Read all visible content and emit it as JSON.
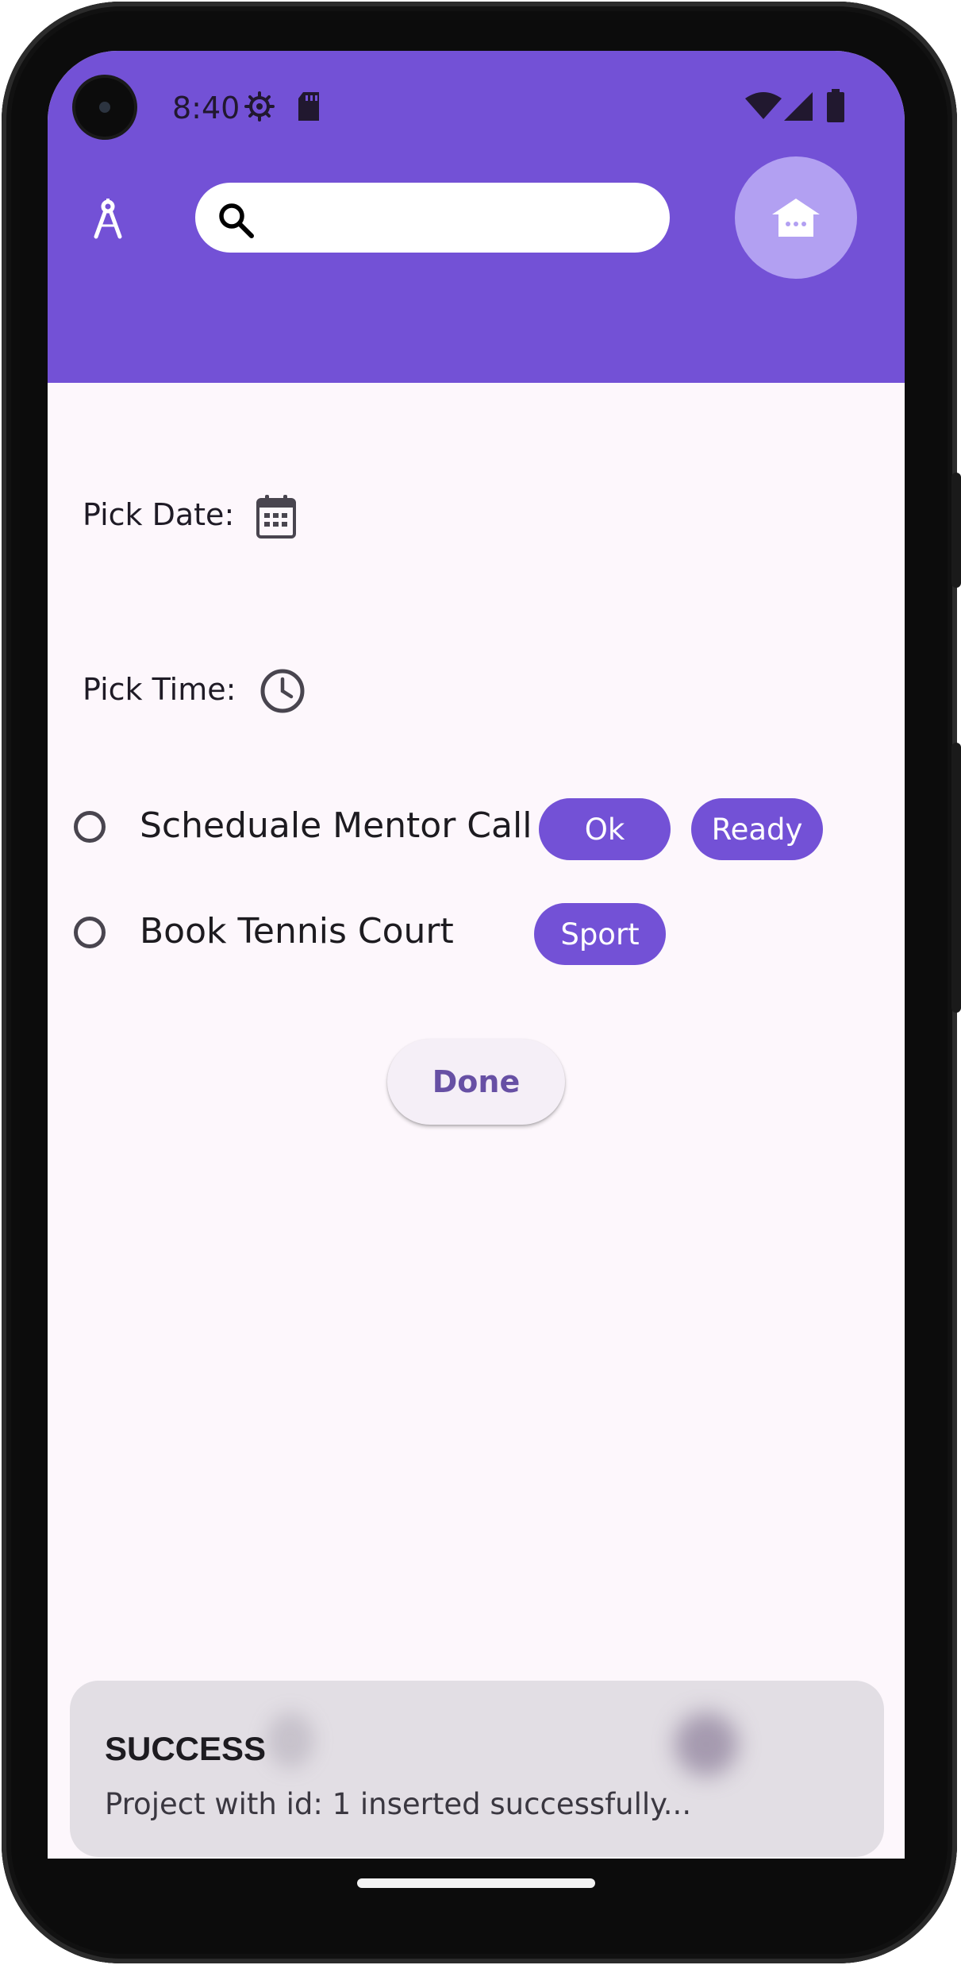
{
  "status_bar": {
    "time": "8:40"
  },
  "app_bar": {
    "search": {
      "value": "",
      "placeholder": ""
    },
    "background": "#7351d6",
    "fab_color": "#b2a0f2"
  },
  "form": {
    "pick_date_label": "Pick Date:",
    "pick_time_label": "Pick Time:"
  },
  "tasks": [
    {
      "title": "Scheduale Mentor Call",
      "tags": [
        "Ok",
        "Ready"
      ],
      "checked": false
    },
    {
      "title": "Book Tennis Court",
      "tags": [
        "Sport"
      ],
      "checked": false
    }
  ],
  "done_label": "Done",
  "snackbar": {
    "title": "SUCCESS",
    "message": "Project with id: 1 inserted successfully..."
  },
  "icons": [
    "compass-icon",
    "search-icon",
    "home-icon",
    "calendar-icon",
    "clock-icon",
    "settings-icon",
    "sd-card-icon",
    "wifi-icon",
    "signal-icon",
    "battery-icon"
  ]
}
